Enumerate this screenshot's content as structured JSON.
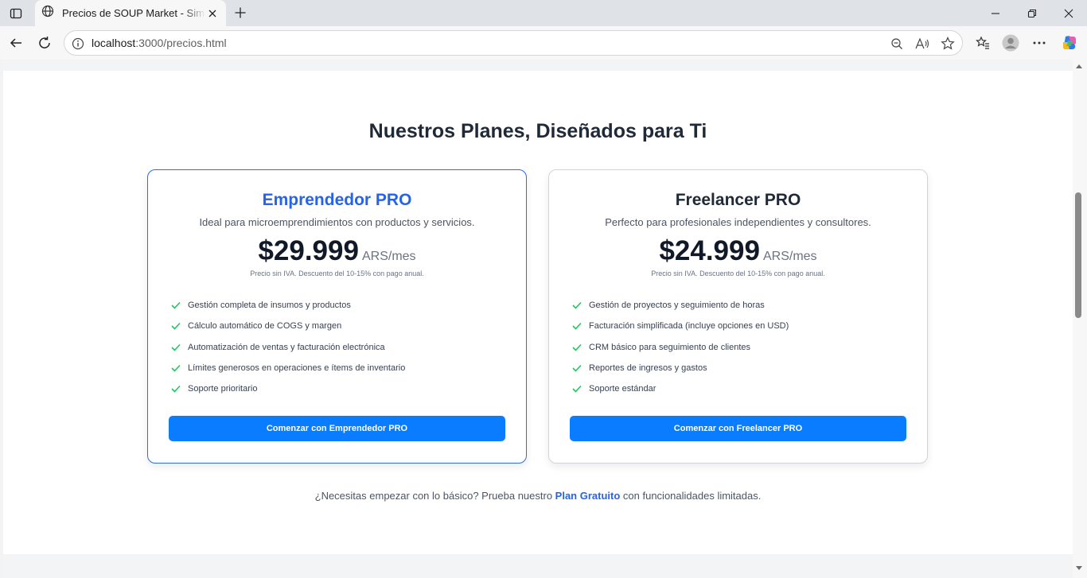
{
  "browser": {
    "tab_title": "Precios de SOUP Market - Simplifica",
    "url_host": "localhost",
    "url_path": ":3000/precios.html"
  },
  "page": {
    "heading": "Nuestros Planes, Diseñados para Ti",
    "plans": [
      {
        "title": "Emprendedor PRO",
        "description": "Ideal para microemprendimientos con productos y servicios.",
        "price": "$29.999",
        "unit": "ARS/mes",
        "note": "Precio sin IVA. Descuento del 10-15% con pago anual.",
        "features": [
          "Gestión completa de insumos y productos",
          "Cálculo automático de COGS y margen",
          "Automatización de ventas y facturación electrónica",
          "Límites generosos en operaciones e ítems de inventario",
          "Soporte prioritario"
        ],
        "cta": "Comenzar con Emprendedor PRO"
      },
      {
        "title": "Freelancer PRO",
        "description": "Perfecto para profesionales independientes y consultores.",
        "price": "$24.999",
        "unit": "ARS/mes",
        "note": "Precio sin IVA. Descuento del 10-15% con pago anual.",
        "features": [
          "Gestión de proyectos y seguimiento de horas",
          "Facturación simplificada (incluye opciones en USD)",
          "CRM básico para seguimiento de clientes",
          "Reportes de ingresos y gastos",
          "Soporte estándar"
        ],
        "cta": "Comenzar con Freelancer PRO"
      }
    ],
    "footer": {
      "prefix": "¿Necesitas empezar con lo básico? Prueba nuestro ",
      "link": "Plan Gratuito",
      "suffix": " con funcionalidades limitadas."
    }
  },
  "colors": {
    "accent": "#2563eb",
    "button": "#0a7cff",
    "check": "#22c55e"
  },
  "icons": [
    "sidebar-toggle-icon",
    "globe-icon",
    "close-icon",
    "plus-icon",
    "minimize-icon",
    "restore-icon",
    "back-icon",
    "reload-icon",
    "info-icon",
    "zoom-out-icon",
    "read-aloud-icon",
    "star-icon",
    "favorites-icon",
    "profile-icon",
    "more-icon",
    "copilot-icon",
    "check-icon"
  ]
}
